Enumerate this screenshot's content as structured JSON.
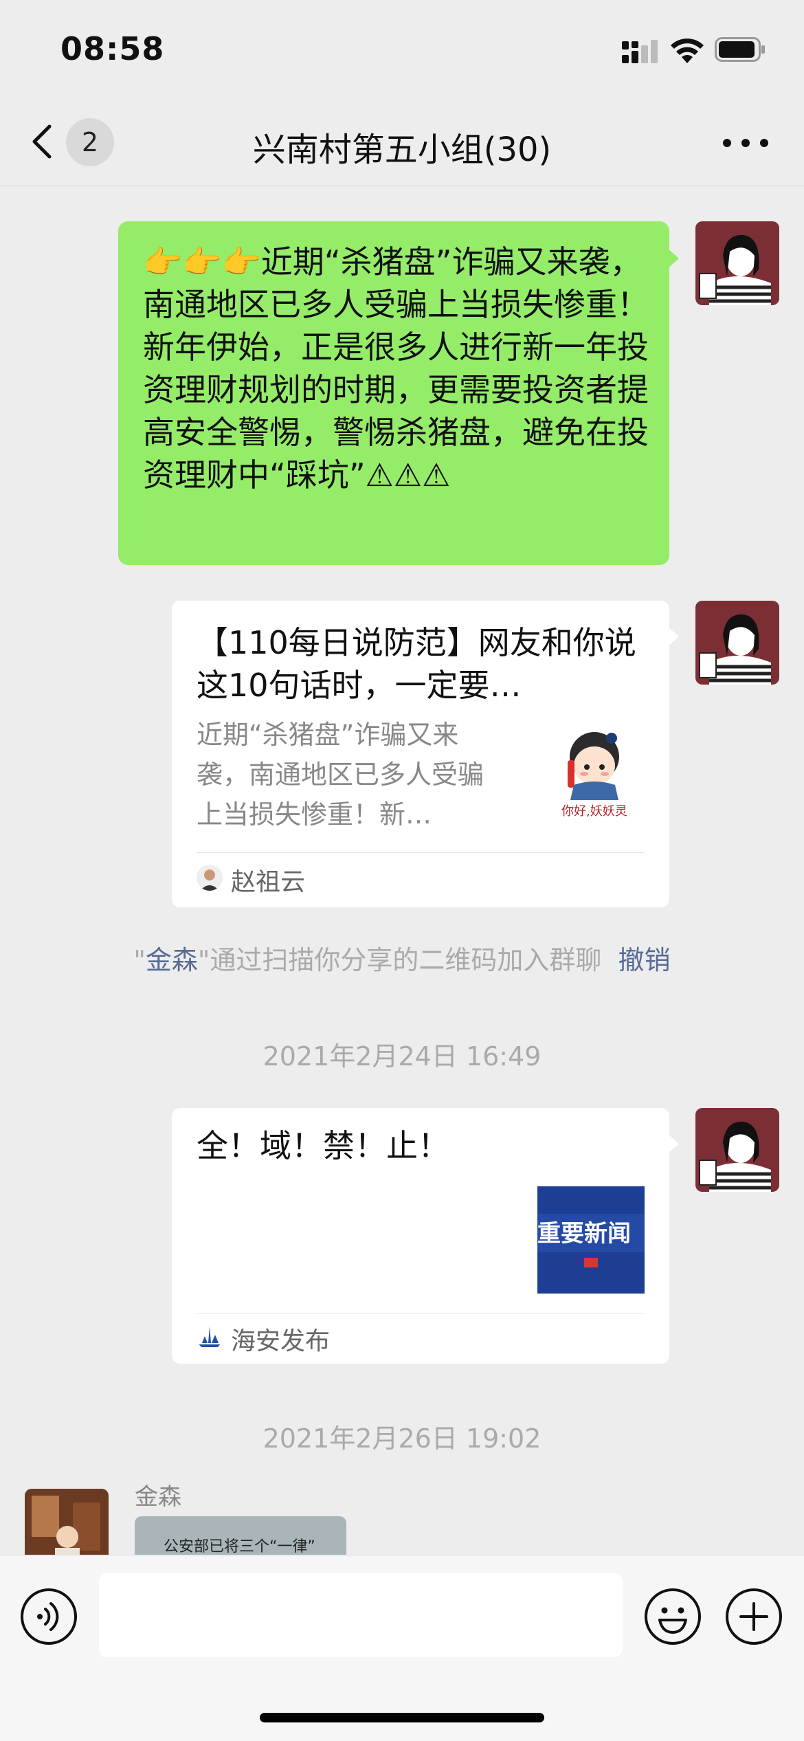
{
  "status_bar": {
    "time": "08:58"
  },
  "nav": {
    "unread_count": "2",
    "title": "兴南村第五小组(30)"
  },
  "messages": {
    "m1_text": "👉👉👉近期“杀猪盘”诈骗又来袭，南通地区已多人受骗上当损失惨重！新年伊始，正是很多人进行新一年投资理财规划的时期，更需要投资者提高安全警惕，警惕杀猪盘，避免在投资理财中“踩坑”⚠⚠⚠",
    "m2_title": "【110每日说防范】网友和你说这10句话时，一定要…",
    "m2_desc": "近期“杀猪盘”诈骗又来袭，南通地区已多人受骗上当损失惨重！新…",
    "m2_thumb_caption": "你好,妖妖灵",
    "m2_source": "赵祖云",
    "sys_prefix": "\"",
    "sys_name": "金森",
    "sys_suffix": "\"通过扫描你分享的二维码加入群聊",
    "sys_action": "撤销",
    "ts1": "2021年2月24日 16:49",
    "m3_title": "全！域！禁！止！",
    "m3_thumb_text": "重要新闻",
    "m3_source": "海安发布",
    "ts2": "2021年2月26日 19:02",
    "m4_sender": "金森",
    "m4_preview": "公安部已将三个“一律”"
  },
  "colors": {
    "bubble_green": "#95ec69",
    "link_blue": "#576b95",
    "background": "#ededed"
  }
}
